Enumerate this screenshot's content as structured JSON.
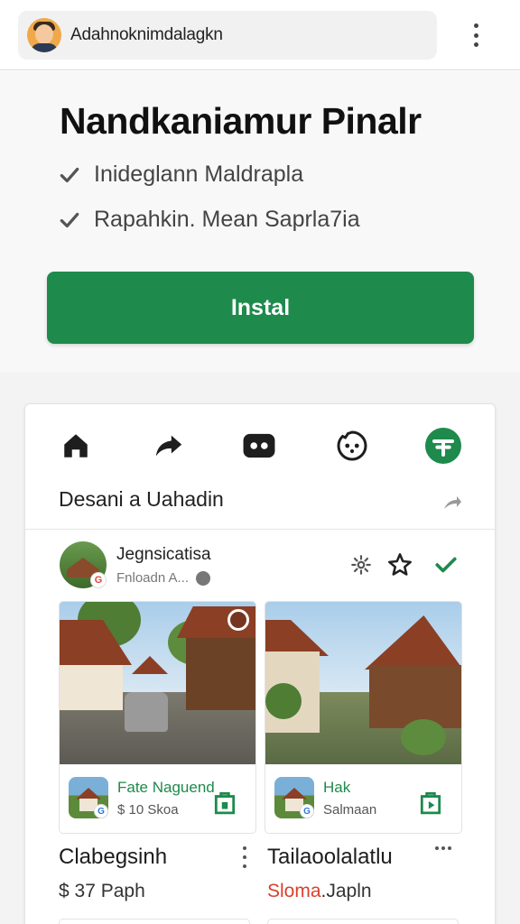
{
  "top_bar": {
    "account_name": "Adahnoknimdalagkn",
    "avatar_icon": "user-avatar-icon",
    "menu_icon": "more-vertical-icon"
  },
  "hero": {
    "title": "Nandkaniamur Pinalr",
    "features": [
      {
        "text": "Inideglann Maldrapla",
        "icon": "check-icon"
      },
      {
        "text": "Rapahkin. Mean Saprla7ia",
        "icon": "check-icon"
      }
    ],
    "install_label": "Instal"
  },
  "nav": {
    "icons": [
      "home-icon",
      "share-icon",
      "gamepad-icon",
      "emoji-icon",
      "dev-tools-icon"
    ],
    "active_index": 4
  },
  "section": {
    "heading": "Desani a Uahadin",
    "arrow_icon": "arrow-icon"
  },
  "profile": {
    "name": "Jegnsicatisa",
    "subtitle": "Fnloadn A...",
    "badge": "G",
    "actions": [
      "settings-icon",
      "star-outline-icon",
      "verified-check-icon"
    ]
  },
  "listings": [
    {
      "card_title": "Fate Naguend",
      "card_price": "$ 10 Skoa",
      "title": "Clabegsinh",
      "price": "$ 37 Paph",
      "thumb_badge": "G"
    },
    {
      "card_title": "Hak",
      "card_price": "Salmaan",
      "title": "Tailaoolalatlu",
      "price_accent": "Sloma",
      "price_rest": ".Japln",
      "thumb_badge": "G"
    }
  ],
  "colors": {
    "brand_green": "#1e8a4c",
    "price_accent_red": "#d9412c"
  }
}
